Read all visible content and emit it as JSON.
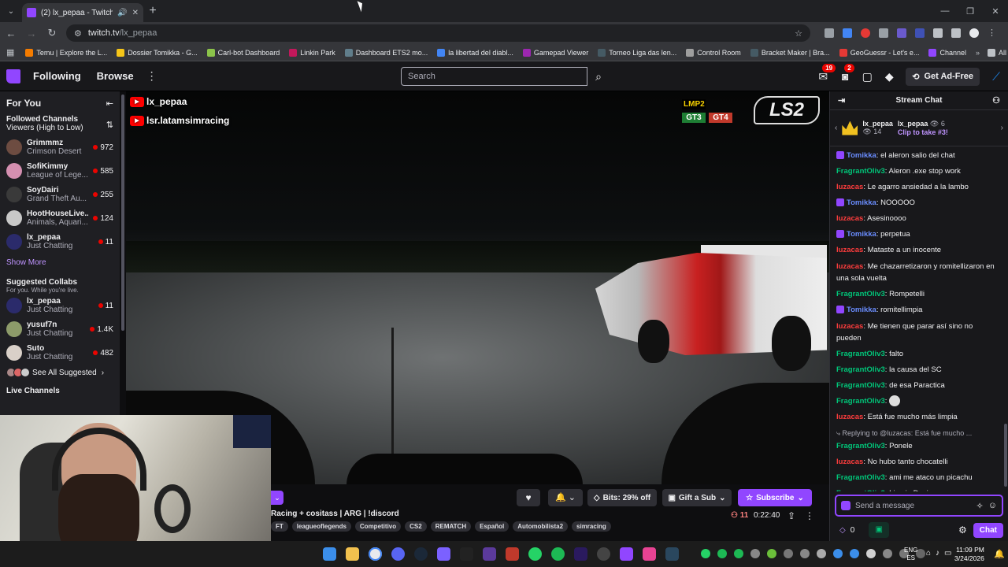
{
  "browser": {
    "tab_title": "(2) lx_pepaa - Twitch",
    "url_host": "twitch.tv",
    "url_path": "/lx_pepaa",
    "bookmarks": [
      {
        "label": "Temu | Explore the L...",
        "color": "#f57c00"
      },
      {
        "label": "Dossier Tomikka - G...",
        "color": "#f5c518"
      },
      {
        "label": "Carl-bot Dashboard",
        "color": "#8bc34a"
      },
      {
        "label": "Linkin Park",
        "color": "#c2185b"
      },
      {
        "label": "Dashboard ETS2 mo...",
        "color": "#607d8b"
      },
      {
        "label": "la libertad del diabl...",
        "color": "#4285f4"
      },
      {
        "label": "Gamepad Viewer",
        "color": "#9c27b0"
      },
      {
        "label": "Torneo Liga das len...",
        "color": "#455a64"
      },
      {
        "label": "Control Room",
        "color": "#9e9e9e"
      },
      {
        "label": "Bracket Maker | Bra...",
        "color": "#455a64"
      },
      {
        "label": "GeoGuessr - Let's e...",
        "color": "#e53935"
      },
      {
        "label": "Channel",
        "color": "#9146ff"
      }
    ],
    "all_bookmarks": "All Bookmarks"
  },
  "twitch_nav": {
    "following": "Following",
    "browse": "Browse",
    "search_placeholder": "Search",
    "inbox_badge": "19",
    "alerts_badge": "2",
    "get_ad_free": "Get Ad-Free"
  },
  "sidebar": {
    "for_you": "For You",
    "followed_title": "Followed Channels",
    "followed_sort": "Viewers (High to Low)",
    "followed": [
      {
        "name": "Grimmmz",
        "game": "Crimson Desert",
        "viewers": "972",
        "color": "#6d4c41"
      },
      {
        "name": "SofiKimmy",
        "game": "League of Lege...",
        "viewers": "585",
        "color": "#d48fb0"
      },
      {
        "name": "SoyDairi",
        "game": "Grand Theft Au...",
        "viewers": "255",
        "color": "#3a3a3a"
      },
      {
        "name": "HootHouseLive...",
        "game": "Animals, Aquari...",
        "viewers": "124",
        "color": "#c8c8c8"
      },
      {
        "name": "lx_pepaa",
        "game": "Just Chatting",
        "viewers": "11",
        "color": "#2b2b6b"
      }
    ],
    "show_more": "Show More",
    "suggested_title": "Suggested Collabs",
    "suggested_sub": "For you. While you're live.",
    "suggested": [
      {
        "name": "lx_pepaa",
        "game": "Just Chatting",
        "viewers": "11",
        "color": "#2b2b6b"
      },
      {
        "name": "yusuf7n",
        "game": "Just Chatting",
        "viewers": "1.4K",
        "color": "#8d9b6a"
      },
      {
        "name": "Suto",
        "game": "Just Chatting",
        "viewers": "482",
        "color": "#d9d0c8"
      }
    ],
    "see_all": "See All Suggested",
    "live_channels": "Live Channels"
  },
  "video": {
    "yt1": "lx_pepaa",
    "yt2": "lsr.latamsimracing",
    "class_tags": [
      {
        "label": "LMP2",
        "bg": "#000000",
        "fg": "#f5d000"
      },
      {
        "label": "",
        "bg": "transparent",
        "fg": "#000"
      },
      {
        "label": "GT3",
        "bg": "#1e7e34",
        "fg": "#ffffff"
      },
      {
        "label": "GT4",
        "bg": "#c0392b",
        "fg": "#ffffff"
      }
    ],
    "ls_logo": "LS2"
  },
  "stream_info": {
    "title": "Racing + cositass | ARG | !discord",
    "tags": [
      "FT",
      "leagueoflegends",
      "Competitivo",
      "CS2",
      "REMATCH",
      "Español",
      "Automobilista2",
      "simracing"
    ],
    "bits": "Bits: 29% off",
    "gift": "Gift a Sub",
    "subscribe": "Subscribe",
    "viewers": "11",
    "uptime": "0:22:40"
  },
  "chat": {
    "header": "Stream Chat",
    "leader1_name": "lx_pepaa",
    "leader1_views": "14",
    "leader2_name": "lx_pepaa",
    "leader2_views": "6",
    "leader2_clip": "Clip to take #3!",
    "messages": [
      {
        "user": "Tomikka",
        "color": "blue",
        "badge": true,
        "text": "el aleron salio del chat"
      },
      {
        "user": "FragrantOliv3",
        "color": "green",
        "badge": false,
        "text": "Aleron .exe stop work"
      },
      {
        "user": "luzacas",
        "color": "red",
        "badge": false,
        "text": "Le agarro ansiedad a la lambo"
      },
      {
        "user": "Tomikka",
        "color": "blue",
        "badge": true,
        "text": "NOOOOO"
      },
      {
        "user": "luzacas",
        "color": "red",
        "badge": false,
        "text": "Asesinoooo"
      },
      {
        "user": "Tomikka",
        "color": "blue",
        "badge": true,
        "text": "perpetua"
      },
      {
        "user": "luzacas",
        "color": "red",
        "badge": false,
        "text": "Mataste a un inocente"
      },
      {
        "user": "luzacas",
        "color": "red",
        "badge": false,
        "text": "Me chazarretizaron y romitellizaron en una sola vuelta",
        "wrap": true
      },
      {
        "user": "FragrantOliv3",
        "color": "green",
        "badge": false,
        "text": "Rompetelli"
      },
      {
        "user": "Tomikka",
        "color": "blue",
        "badge": true,
        "text": "romitellimpia"
      },
      {
        "user": "luzacas",
        "color": "red",
        "badge": false,
        "text": "Me tienen que parar así sino no pueden",
        "wrap": true
      },
      {
        "user": "FragrantOliv3",
        "color": "green",
        "badge": false,
        "text": "falto"
      },
      {
        "user": "FragrantOliv3",
        "color": "green",
        "badge": false,
        "text": "la causa del SC"
      },
      {
        "user": "FragrantOliv3",
        "color": "green",
        "badge": false,
        "text": "de esa Paractica"
      },
      {
        "user": "FragrantOliv3",
        "color": "green",
        "badge": false,
        "text": "",
        "emote": true
      },
      {
        "user": "luzacas",
        "color": "red",
        "badge": false,
        "text": "Está fue mucho más limpia"
      }
    ],
    "reply_to": "Replying to @luzacas: Está fue mucho ...",
    "messages2": [
      {
        "user": "FragrantOliv3",
        "color": "green",
        "text": "Ponele"
      },
      {
        "user": "luzacas",
        "color": "red",
        "text": "No hubo tanto chocatelli"
      },
      {
        "user": "FragrantOliv3",
        "color": "green",
        "text": "ami me ataco un picachu"
      },
      {
        "user": "FragrantOliv3",
        "color": "green",
        "text": "Limpio Decian"
      }
    ],
    "input_placeholder": "Send a message",
    "points": "0",
    "send": "Chat"
  },
  "taskbar": {
    "lang1": "ENG",
    "lang2": "ES",
    "time": "11:09 PM",
    "date": "3/24/2026"
  }
}
